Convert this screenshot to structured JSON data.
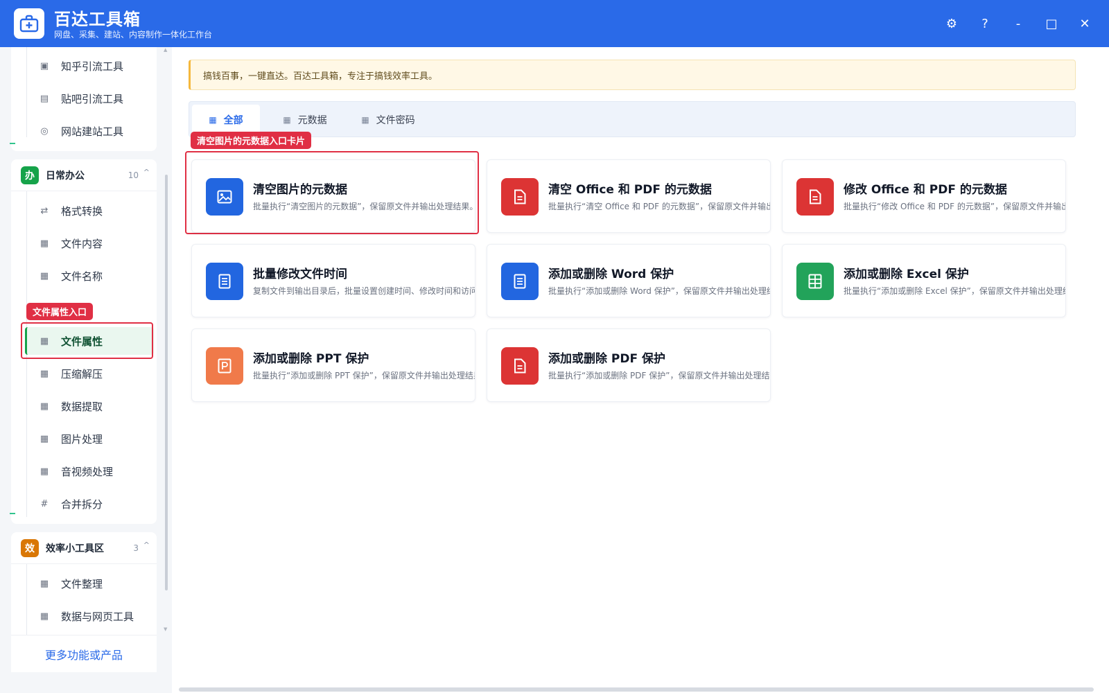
{
  "app": {
    "title": "百达工具箱",
    "subtitle": "网盘、采集、建站、内容制作一体化工作台",
    "controls": {
      "settings": "⚙",
      "help": "?",
      "minimize": "-",
      "maximize": "□",
      "close": "✕"
    }
  },
  "sidebar": {
    "top_items": [
      {
        "label": "知乎引流工具",
        "icon": "zhihu-icon"
      },
      {
        "label": "贴吧引流工具",
        "icon": "tieba-icon"
      },
      {
        "label": "网站建站工具",
        "icon": "web-build-icon"
      }
    ],
    "groups": [
      {
        "badge": "办",
        "badge_color": "#16a34a",
        "title": "日常办公",
        "count": "10",
        "items": [
          {
            "label": "格式转换",
            "icon": "swap-icon"
          },
          {
            "label": "文件内容",
            "icon": "grid-icon"
          },
          {
            "label": "文件名称",
            "icon": "grid-icon"
          },
          {
            "label": "文件属性",
            "icon": "grid-icon",
            "active": true
          },
          {
            "label": "压缩解压",
            "icon": "grid-icon"
          },
          {
            "label": "数据提取",
            "icon": "grid-icon"
          },
          {
            "label": "图片处理",
            "icon": "grid-icon"
          },
          {
            "label": "音视频处理",
            "icon": "grid-icon"
          },
          {
            "label": "合并拆分",
            "icon": "hash-icon"
          }
        ]
      },
      {
        "badge": "效",
        "badge_color": "#d97706",
        "title": "效率小工具区",
        "count": "3",
        "items": [
          {
            "label": "文件整理",
            "icon": "grid-icon"
          },
          {
            "label": "数据与网页工具",
            "icon": "grid-icon"
          }
        ]
      }
    ],
    "more_label": "更多功能或产品",
    "annotation": "文件属性入口"
  },
  "main": {
    "notice": "搞钱百事，一键直达。百达工具箱，专注于搞钱效率工具。",
    "tabs": [
      {
        "label": "全部",
        "active": true
      },
      {
        "label": "元数据"
      },
      {
        "label": "文件密码"
      }
    ],
    "annotation": "清空图片的元数据入口卡片",
    "cards": [
      {
        "title": "清空图片的元数据",
        "desc": "批量执行“清空图片的元数据”，保留原文件并输出处理结果。",
        "color": "#2266e0",
        "icon": "image-icon"
      },
      {
        "title": "清空 Office 和 PDF 的元数据",
        "desc": "批量执行“清空 Office 和 PDF 的元数据”，保留原文件并输出处理结果。",
        "color": "#dc3434",
        "icon": "document-icon"
      },
      {
        "title": "修改 Office 和 PDF 的元数据",
        "desc": "批量执行“修改 Office 和 PDF 的元数据”，保留原文件并输出处理结果。",
        "color": "#dc3434",
        "icon": "document-icon"
      },
      {
        "title": "批量修改文件时间",
        "desc": "复制文件到输出目录后，批量设置创建时间、修改时间和访问时间。",
        "color": "#2266e0",
        "icon": "file-lines-icon"
      },
      {
        "title": "添加或删除 Word 保护",
        "desc": "批量执行“添加或删除 Word 保护”，保留原文件并输出处理结果。",
        "color": "#2266e0",
        "icon": "file-lines-icon"
      },
      {
        "title": "添加或删除 Excel 保护",
        "desc": "批量执行“添加或删除 Excel 保护”，保留原文件并输出处理结果。",
        "color": "#22a35a",
        "icon": "table-icon"
      },
      {
        "title": "添加或删除 PPT 保护",
        "desc": "批量执行“添加或删除 PPT 保护”，保留原文件并输出处理结果。",
        "color": "#f07a4a",
        "icon": "slides-icon"
      },
      {
        "title": "添加或删除 PDF 保护",
        "desc": "批量执行“添加或删除 PDF 保护”，保留原文件并输出处理结果。",
        "color": "#dc3434",
        "icon": "document-icon"
      }
    ]
  }
}
